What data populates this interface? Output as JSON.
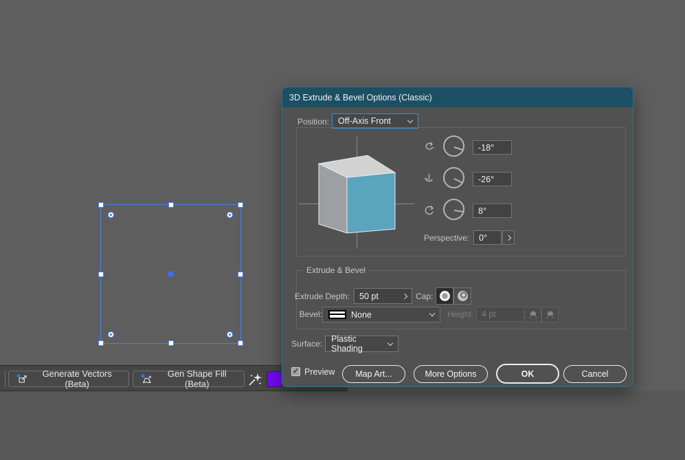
{
  "workspace": {
    "canvas_color": "#5e5e5e",
    "selection_color": "#4d7fe3"
  },
  "toolbar": {
    "generate_vectors_label": "Generate Vectors (Beta)",
    "gen_shape_fill_label": "Gen Shape Fill (Beta)",
    "swatch_color": "#7209f5",
    "beta_dot_color": "#2f7fe0"
  },
  "dialog": {
    "title": "3D Extrude & Bevel Options (Classic)",
    "colors": {
      "titlebar": "#1c4f63",
      "body": "#515151",
      "focus_border": "#3f8fd6"
    },
    "position_label": "Position:",
    "position_value": "Off-Axis Front",
    "rotate_x_value": "-18°",
    "rotate_y_value": "-26°",
    "rotate_z_value": "8°",
    "perspective_label": "Perspective:",
    "perspective_value": "0°",
    "cube": {
      "top": "#d2d2d2",
      "left": "#9da0a2",
      "front": "#5ba4bd"
    },
    "extrude_bevel": {
      "legend": "Extrude & Bevel",
      "extrude_depth_label": "Extrude Depth:",
      "extrude_depth_value": "50 pt",
      "cap_label": "Cap:",
      "bevel_label": "Bevel:",
      "bevel_value": "None",
      "height_label": "Height:",
      "height_value": "4 pt"
    },
    "surface_label": "Surface:",
    "surface_value": "Plastic Shading",
    "footer": {
      "preview_label": "Preview",
      "preview_checked": true,
      "map_art_label": "Map Art...",
      "more_options_label": "More Options",
      "ok_label": "OK",
      "cancel_label": "Cancel"
    }
  }
}
